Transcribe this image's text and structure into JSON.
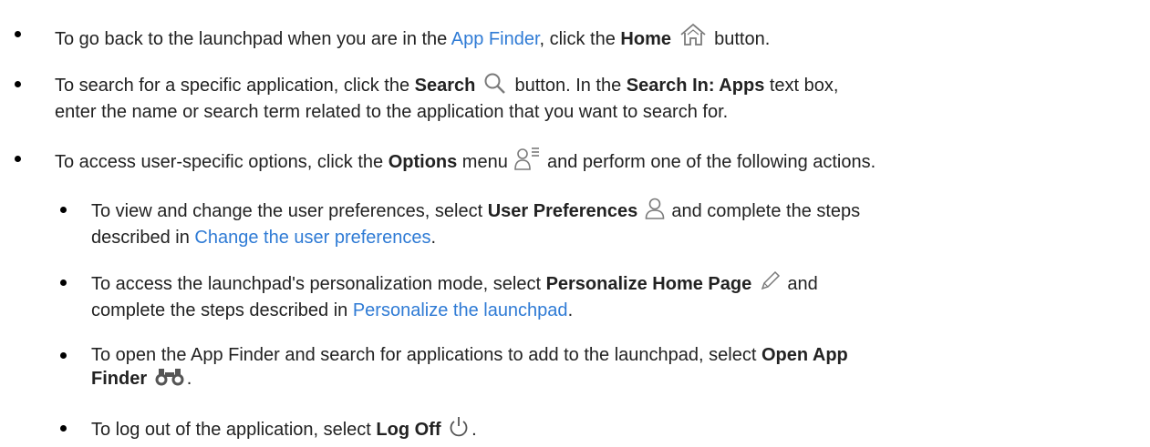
{
  "icons": {
    "home": "home-icon",
    "search": "search-icon",
    "options": "user-menu-icon",
    "user_preferences": "user-icon",
    "personalize": "pencil-icon",
    "app_finder": "binoculars-icon",
    "log_off": "power-icon"
  },
  "colors": {
    "link": "#2f7bd5",
    "icon": "#7a7a7a"
  },
  "items": {
    "home": {
      "t1": "To go back to the launchpad when you are in the ",
      "link": "App Finder",
      "t2": ", click the ",
      "bold": "Home",
      "t3": " button."
    },
    "search": {
      "t1": "To search for a specific application, click the ",
      "bold1": "Search",
      "t2": " button. In the ",
      "bold2": "Search In: Apps",
      "t3": " text box,",
      "line2": "enter the name or search term related to the application that you want to search for."
    },
    "options": {
      "t1": "To access user-specific options, click the ",
      "bold": "Options",
      "t2": " menu ",
      "t3": " and perform one of the following actions."
    },
    "user_prefs": {
      "t1": "To view and change the user preferences, select ",
      "bold": "User Preferences",
      "t2": " and complete the steps",
      "t3": "described in ",
      "link": "Change the user preferences",
      "t4": "."
    },
    "personalize": {
      "t1": "To access the launchpad's personalization mode, select ",
      "bold": "Personalize Home Page",
      "t2": " and",
      "t3": "complete the steps described in ",
      "link": "Personalize the launchpad",
      "t4": "."
    },
    "app_finder": {
      "t1": "To open the App Finder and search for applications to add to the launchpad, select ",
      "bold1": "Open App",
      "bold2": "Finder",
      "t2": "."
    },
    "log_off": {
      "t1": "To log out of the application, select ",
      "bold": "Log Off",
      "t2": "."
    }
  }
}
